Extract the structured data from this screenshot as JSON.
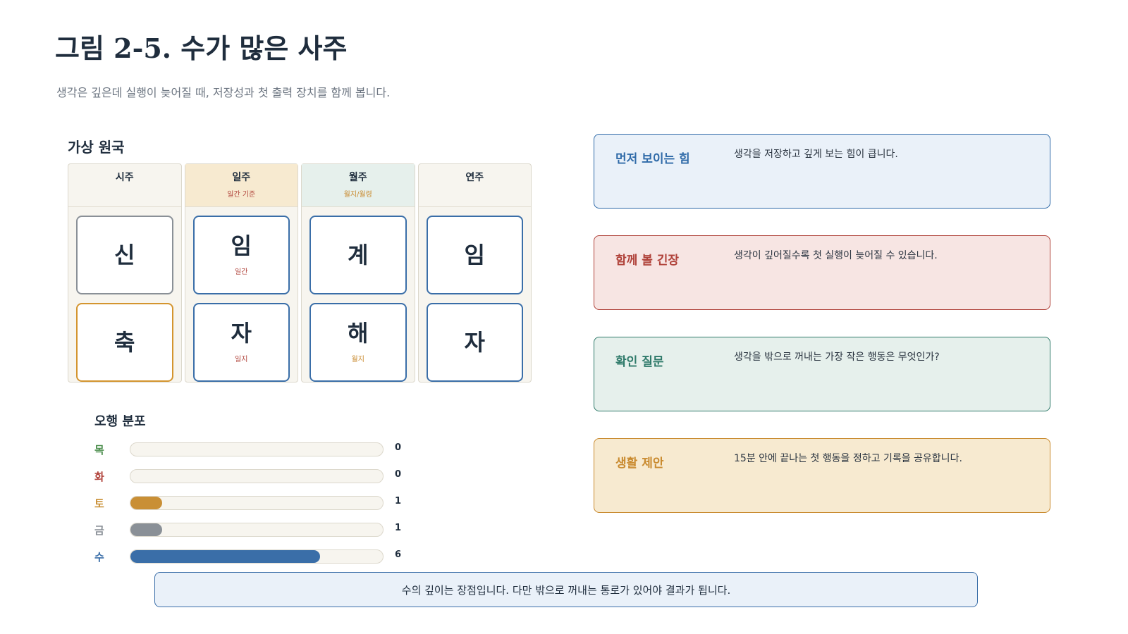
{
  "figure": {
    "title": "그림 2-5. 수가 많은 사주",
    "subtitle": "생각은 깊은데 실행이 늦어질 때, 저장성과 첫 출력 장치를 함께 봅니다."
  },
  "chart": {
    "title": "가상 원국",
    "pillars": [
      {
        "name": "시주",
        "note": "",
        "stem": "신",
        "stem_tag": "",
        "branch": "축",
        "branch_tag": ""
      },
      {
        "name": "일주",
        "note": "일간 기준",
        "stem": "임",
        "stem_tag": "일간",
        "branch": "자",
        "branch_tag": "일지"
      },
      {
        "name": "월주",
        "note": "월지/월령",
        "stem": "계",
        "stem_tag": "",
        "branch": "해",
        "branch_tag": "월지"
      },
      {
        "name": "연주",
        "note": "",
        "stem": "임",
        "stem_tag": "",
        "branch": "자",
        "branch_tag": ""
      }
    ]
  },
  "elements": {
    "title": "오행 분포",
    "max": 8,
    "items": [
      {
        "label": "목",
        "value": 0,
        "color": "#4e8f4f"
      },
      {
        "label": "화",
        "value": 0,
        "color": "#b0423a"
      },
      {
        "label": "토",
        "value": 1,
        "color": "#c98f35"
      },
      {
        "label": "금",
        "value": 1,
        "color": "#8a9097"
      },
      {
        "label": "수",
        "value": 6,
        "color": "#3a6ea8"
      }
    ]
  },
  "cards": [
    {
      "label": "먼저 보이는 힘",
      "text": "생각을 저장하고 깊게 보는 힘이 큽니다.",
      "accent": "#2f6aa8",
      "bg": "#eaf1f9"
    },
    {
      "label": "함께 볼 긴장",
      "text": "생각이 깊어질수록 첫 실행이 늦어질 수 있습니다.",
      "accent": "#b0423a",
      "bg": "#f7e5e3"
    },
    {
      "label": "확인 질문",
      "text": "생각을 밖으로 꺼내는 가장 작은 행동은 무엇인가?",
      "accent": "#2f7a6a",
      "bg": "#e6f0ec"
    },
    {
      "label": "생활 제안",
      "text": "15분 안에 끝나는 첫 행동을 정하고 기록을 공유합니다.",
      "accent": "#c98a2e",
      "bg": "#f7ead0"
    }
  ],
  "footnote": "수의 깊이는 장점입니다. 다만 밖으로 꺼내는 통로가 있어야 결과가 됩니다."
}
